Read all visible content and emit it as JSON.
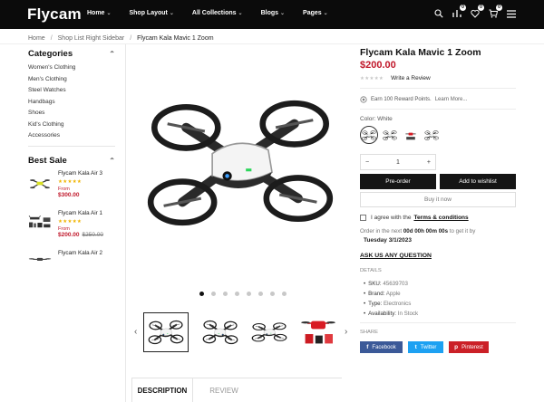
{
  "header": {
    "logo": "Flycam",
    "nav": [
      {
        "label": "Home"
      },
      {
        "label": "Shop Layout"
      },
      {
        "label": "All Collections"
      },
      {
        "label": "Blogs"
      },
      {
        "label": "Pages"
      }
    ],
    "compare_count": "0",
    "wishlist_count": "0",
    "cart_count": "0"
  },
  "breadcrumb": [
    "Home",
    "Shop List Right Sidebar",
    "Flycam Kala Mavic 1 Zoom"
  ],
  "sidebar": {
    "categories_title": "Categories",
    "categories": [
      "Women's Clothing",
      "Men's Clothing",
      "Steel Watches",
      "Handbags",
      "Shoes",
      "Kid's Clothing",
      "Accessories"
    ],
    "bestsale_title": "Best Sale",
    "products": [
      {
        "name": "Flycam Kala Air 3",
        "from": "From",
        "price": "$300.00",
        "old_price": ""
      },
      {
        "name": "Flycam Kala Air 1",
        "from": "From",
        "price": "$200.00",
        "old_price": "$250.00"
      },
      {
        "name": "Flycam Kala Air 2",
        "from": "",
        "price": "",
        "old_price": ""
      }
    ]
  },
  "product": {
    "title": "Flycam Kala Mavic 1 Zoom",
    "price": "$200.00",
    "rating_stars": "★★★★★",
    "rating": 0,
    "write_review": "Write a Review",
    "reward_text": "Earn 100 Reward Points.",
    "learn_more": "Learn More...",
    "color_label": "Color: White",
    "quantity": "1",
    "qty_minus": "−",
    "qty_plus": "+",
    "preorder": "Pre-order",
    "add_wishlist": "Add to wishlist",
    "buy_now": "Buy it now",
    "agree_text": "I agree with the",
    "terms": "Terms & conditions",
    "order_prefix": "Order in the next",
    "countdown": "00d 00h 00m 00s",
    "order_suffix": "to get it by",
    "delivery_date": "Tuesday 3/1/2023",
    "ask_question": "ASK US ANY QUESTION",
    "details_label": "DETAILS",
    "details": [
      {
        "key": "SKU:",
        "value": "45639703"
      },
      {
        "key": "Brand:",
        "value": "Apple"
      },
      {
        "key": "Type:",
        "value": "Electronics"
      },
      {
        "key": "Availability:",
        "value": "In Stock"
      }
    ],
    "share_label": "SHARE",
    "share": [
      {
        "icon": "f",
        "label": "Facebook",
        "color": "#3b5998"
      },
      {
        "icon": "t",
        "label": "Twitter",
        "color": "#1da1f2"
      },
      {
        "icon": "p",
        "label": "Pinterest",
        "color": "#cb2027"
      }
    ]
  },
  "gallery": {
    "active_index": 0,
    "dot_count": 8,
    "prev_arrow": "‹",
    "next_arrow": "›"
  },
  "tabs": [
    "DESCRIPTION",
    "REVIEW"
  ],
  "colors": {
    "price_red": "#c0172a",
    "header_bg": "#0b0b0b",
    "button_dark": "#151515",
    "star_gold": "#f0b400"
  }
}
